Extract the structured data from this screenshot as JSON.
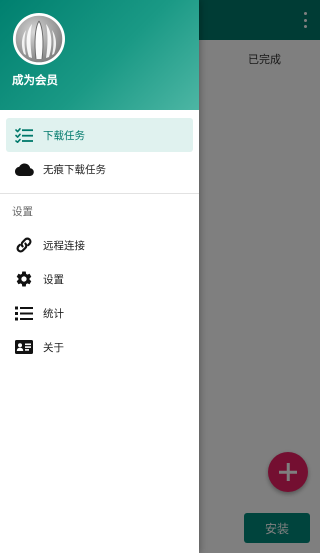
{
  "background_app": {
    "tab_done": "已完成",
    "install_button": "安装",
    "fab_icon": "add-icon",
    "more_icon": "more-vert-icon"
  },
  "drawer": {
    "header": {
      "member_label": "成为会员",
      "avatar_icon": "app-logo-icon"
    },
    "items": [
      {
        "label": "下载任务",
        "icon": "checklist-icon",
        "active": true
      },
      {
        "label": "无痕下载任务",
        "icon": "cloud-icon",
        "active": false
      }
    ],
    "settings_section": {
      "title": "设置",
      "items": [
        {
          "label": "远程连接",
          "icon": "link-icon"
        },
        {
          "label": "设置",
          "icon": "gear-icon"
        },
        {
          "label": "统计",
          "icon": "list-icon"
        },
        {
          "label": "关于",
          "icon": "id-card-icon"
        }
      ]
    }
  },
  "colors": {
    "primary": "#00796b",
    "accent": "#e91e63",
    "active_bg": "#e0f2ef"
  }
}
